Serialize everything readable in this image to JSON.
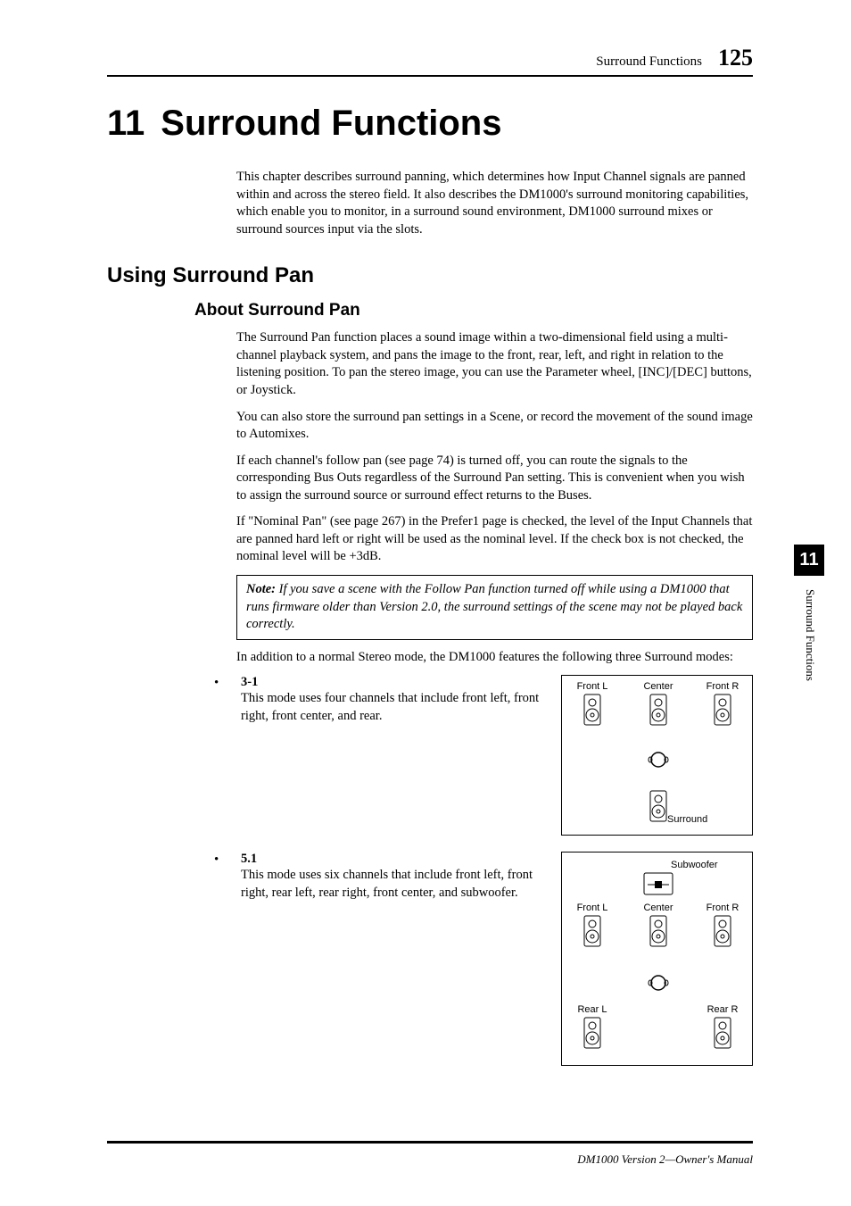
{
  "header": {
    "title": "Surround Functions",
    "page": "125"
  },
  "chapter": {
    "num": "11",
    "title": "Surround Functions"
  },
  "intro": "This chapter describes surround panning, which determines how Input Channel signals are panned within and across the stereo field. It also describes the DM1000's surround monitoring capabilities, which enable you to monitor, in a surround sound environment, DM1000 surround mixes or surround sources input via the slots.",
  "section_h2": "Using Surround Pan",
  "section_h3": "About Surround Pan",
  "paras": {
    "p1": "The Surround Pan function places a sound image within a two-dimensional field using a multi-channel playback system, and pans the image to the front, rear, left, and right in relation to the listening position. To pan the stereo image, you can use the Parameter wheel, [INC]/[DEC] buttons, or Joystick.",
    "p2": "You can also store the surround pan settings in a Scene, or record the movement of the sound image to Automixes.",
    "p3": "If each channel's follow pan (see page 74) is turned off, you can route the signals to the corresponding Bus Outs regardless of the Surround Pan setting. This is convenient when you wish to assign the surround source or surround effect returns to the Buses.",
    "p4": "If \"Nominal Pan\" (see page 267) in the Prefer1 page is checked, the level of the Input Channels that are panned hard left or right will be used as the nominal level. If the check box is not checked, the nominal level will be +3dB.",
    "note_label": "Note:",
    "note": " If you save a scene with the Follow Pan function turned off while using a DM1000 that runs firmware older than Version 2.0, the surround settings of the scene may not be played back correctly.",
    "p5": "In addition to a normal Stereo mode, the DM1000 features the following three Surround modes:"
  },
  "modes": {
    "m31": {
      "name": "3-1",
      "desc": "This mode uses four channels that include front left, front right, front center, and rear."
    },
    "m51": {
      "name": "5.1",
      "desc": "This mode uses six channels that include front left, front right, rear left, rear right, front center, and subwoofer."
    }
  },
  "labels": {
    "front_l": "Front L",
    "center": "Center",
    "front_r": "Front R",
    "surround": "Surround",
    "subwoofer": "Subwoofer",
    "rear_l": "Rear L",
    "rear_r": "Rear R"
  },
  "side": {
    "num": "11",
    "text": "Surround Functions"
  },
  "footer": "DM1000 Version 2—Owner's Manual"
}
